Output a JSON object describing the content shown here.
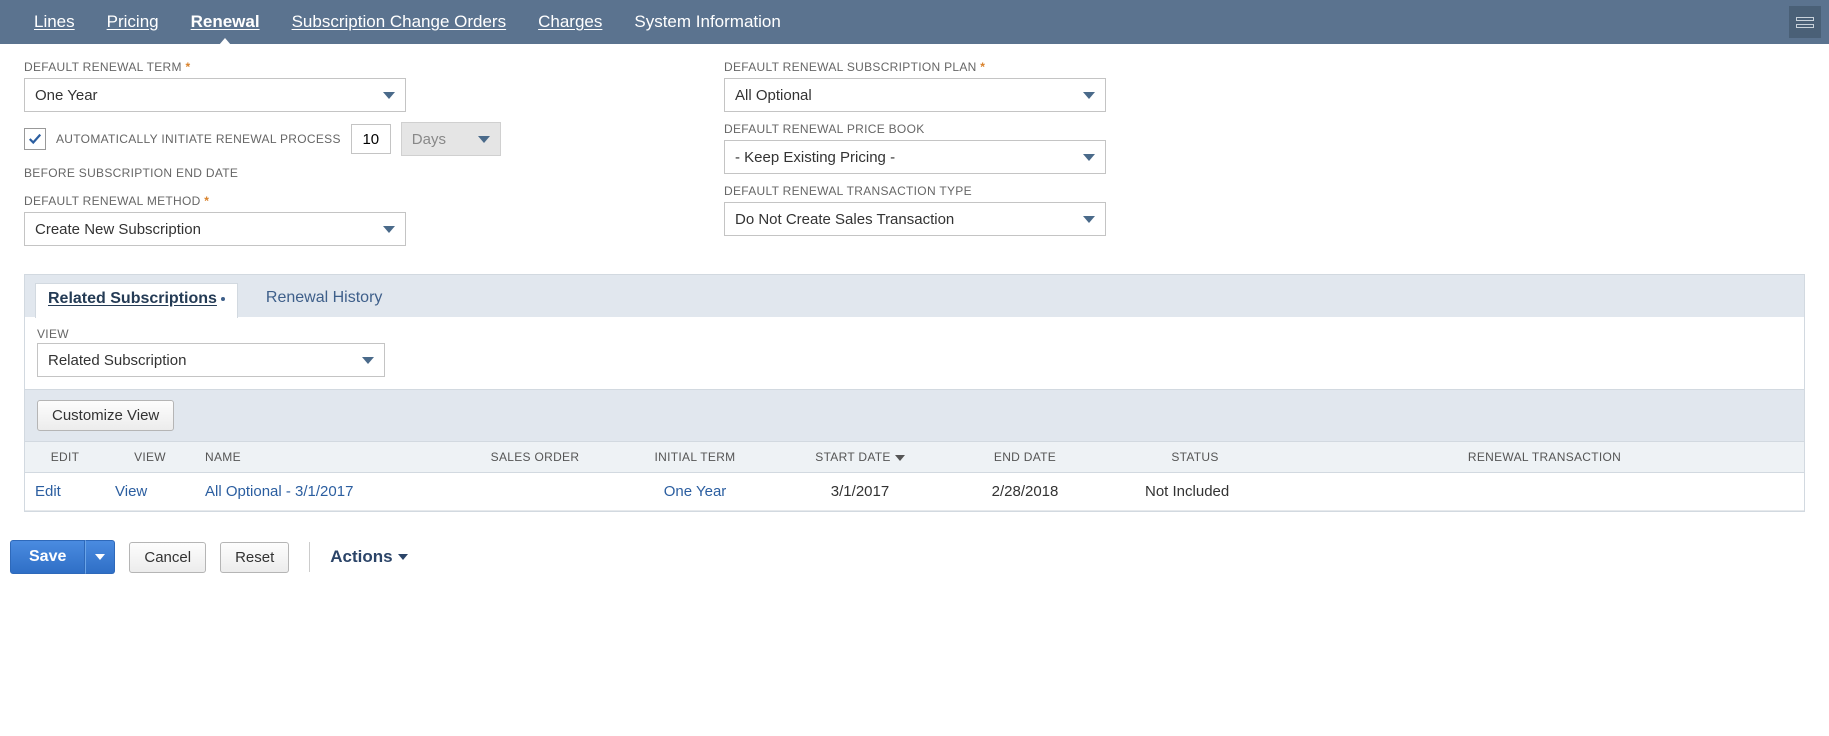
{
  "tabs": {
    "lines": "Lines",
    "pricing": "Pricing",
    "renewal": "Renewal",
    "sco": "Subscription Change Orders",
    "charges": "Charges",
    "sysinfo": "System Information"
  },
  "left": {
    "default_renewal_term_label": "DEFAULT RENEWAL TERM",
    "default_renewal_term_value": "One Year",
    "auto_initiate_label": "AUTOMATICALLY INITIATE RENEWAL PROCESS",
    "auto_initiate_days_value": "10",
    "auto_initiate_unit": "Days",
    "before_end_label": "BEFORE SUBSCRIPTION END DATE",
    "default_renewal_method_label": "DEFAULT RENEWAL METHOD",
    "default_renewal_method_value": "Create New Subscription"
  },
  "right": {
    "default_plan_label": "DEFAULT RENEWAL SUBSCRIPTION PLAN",
    "default_plan_value": "All Optional",
    "default_price_book_label": "DEFAULT RENEWAL PRICE BOOK",
    "default_price_book_value": "- Keep Existing Pricing -",
    "default_txn_type_label": "DEFAULT RENEWAL TRANSACTION TYPE",
    "default_txn_type_value": "Do Not Create Sales Transaction"
  },
  "subtabs": {
    "related": "Related Subscriptions",
    "history": "Renewal History"
  },
  "viewrow": {
    "label": "VIEW",
    "value": "Related Subscription",
    "customize_btn": "Customize View"
  },
  "grid": {
    "headers": {
      "edit": "EDIT",
      "view": "VIEW",
      "name": "NAME",
      "sales_order": "SALES ORDER",
      "initial_term": "INITIAL TERM",
      "start_date": "START DATE",
      "end_date": "END DATE",
      "status": "STATUS",
      "renewal_txn": "RENEWAL TRANSACTION"
    },
    "rows": [
      {
        "edit": "Edit",
        "view": "View",
        "name": "All Optional - 3/1/2017",
        "sales_order": "",
        "initial_term": "One Year",
        "start_date": "3/1/2017",
        "end_date": "2/28/2018",
        "status": "Not Included",
        "renewal_txn": ""
      }
    ]
  },
  "footer": {
    "save": "Save",
    "cancel": "Cancel",
    "reset": "Reset",
    "actions": "Actions"
  }
}
